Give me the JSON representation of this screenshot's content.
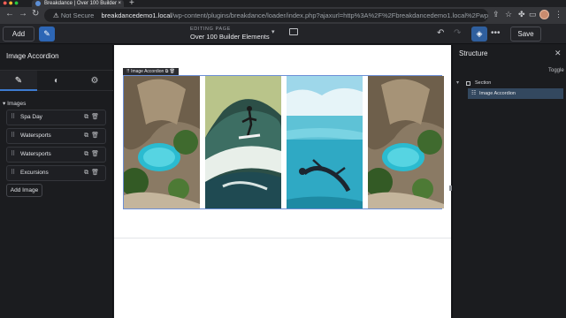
{
  "browser": {
    "tab_title": "Breakdance | Over 100 Builder",
    "url_not_secure": "Not Secure",
    "url_host": "breakdancedemo1.local",
    "url_path": "/wp-content/plugins/breakdance/loader/index.php?ajaxurl=http%3A%2F%2Fbreakdancedemo1.local%2Fwp-admin%2Fadmin-..."
  },
  "topbar": {
    "add_label": "Add",
    "editing_label": "EDITING PAGE",
    "editing_value": "Over 100 Builder Elements",
    "save_label": "Save"
  },
  "left_panel": {
    "title": "Image Accordion",
    "section_title": "Images",
    "images": [
      {
        "label": "Spa Day"
      },
      {
        "label": "Watersports"
      },
      {
        "label": "Watersports"
      },
      {
        "label": "Excursions"
      }
    ],
    "add_image_label": "Add Image"
  },
  "canvas": {
    "element_label": "Image Accordion"
  },
  "right_panel": {
    "title": "Structure",
    "toggle_label": "Toggle",
    "tree": [
      {
        "label": "Section"
      },
      {
        "label": "Image Accordion"
      }
    ]
  },
  "icons": {
    "edit": "pencil-icon",
    "style": "palette-icon",
    "settings": "gear-icon",
    "layers": "layers-icon",
    "undo": "undo-icon",
    "redo": "redo-icon"
  },
  "colors": {
    "accent": "#2d66b5",
    "selection": "#33485f",
    "outline": "#6c8fd6"
  }
}
